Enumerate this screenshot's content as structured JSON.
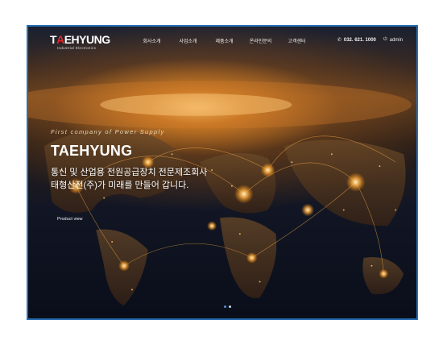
{
  "logo": {
    "brand": "TAEHYUNG",
    "brand_first": "T",
    "brand_accent": "A",
    "brand_rest": "EHYUNG",
    "sub": "Industrial Electronics"
  },
  "nav": {
    "items": [
      "회사소개",
      "사업소개",
      "제품소개",
      "온라인문의",
      "고객센터"
    ]
  },
  "contact": {
    "phone": "032. 621. 1000",
    "admin_label": "admin",
    "phone_icon": "phone-icon",
    "admin_icon": "power-icon"
  },
  "hero": {
    "tagline": "First company of Power Supply",
    "brand": "TAEHYUNG",
    "desc_line1": "통신 및 산업용 전원공급장치 전문제조회사",
    "desc_line2": "태형산전(주)가 미래를 만들어 갑니다.",
    "cta": "Product view"
  },
  "slider": {
    "count": 2,
    "active_index": 0
  },
  "colors": {
    "accent_red": "#e3262b",
    "frame_blue": "#2a6fb5",
    "glow": "#ffb347"
  }
}
